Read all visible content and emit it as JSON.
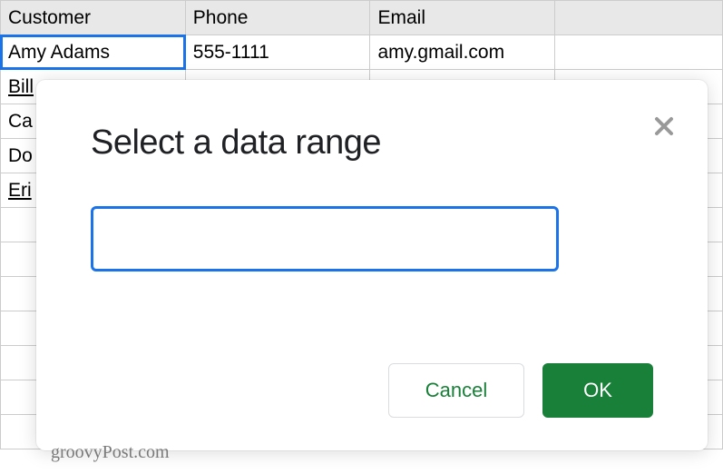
{
  "spreadsheet": {
    "headers": [
      "Customer",
      "Phone",
      "Email"
    ],
    "rows": [
      {
        "customer": "Amy Adams",
        "phone": "555-1111",
        "email": "amy.gmail.com",
        "link": false
      },
      {
        "customer": "Bill",
        "phone": "",
        "email": "",
        "link": true
      },
      {
        "customer": "Ca",
        "phone": "",
        "email": "",
        "link": false
      },
      {
        "customer": "Do",
        "phone": "",
        "email": "",
        "link": false
      },
      {
        "customer": "Eri",
        "phone": "",
        "email": "",
        "link": true
      }
    ]
  },
  "dialog": {
    "title": "Select a data range",
    "input_value": "",
    "cancel_label": "Cancel",
    "ok_label": "OK"
  },
  "watermark": "groovyPost.com"
}
